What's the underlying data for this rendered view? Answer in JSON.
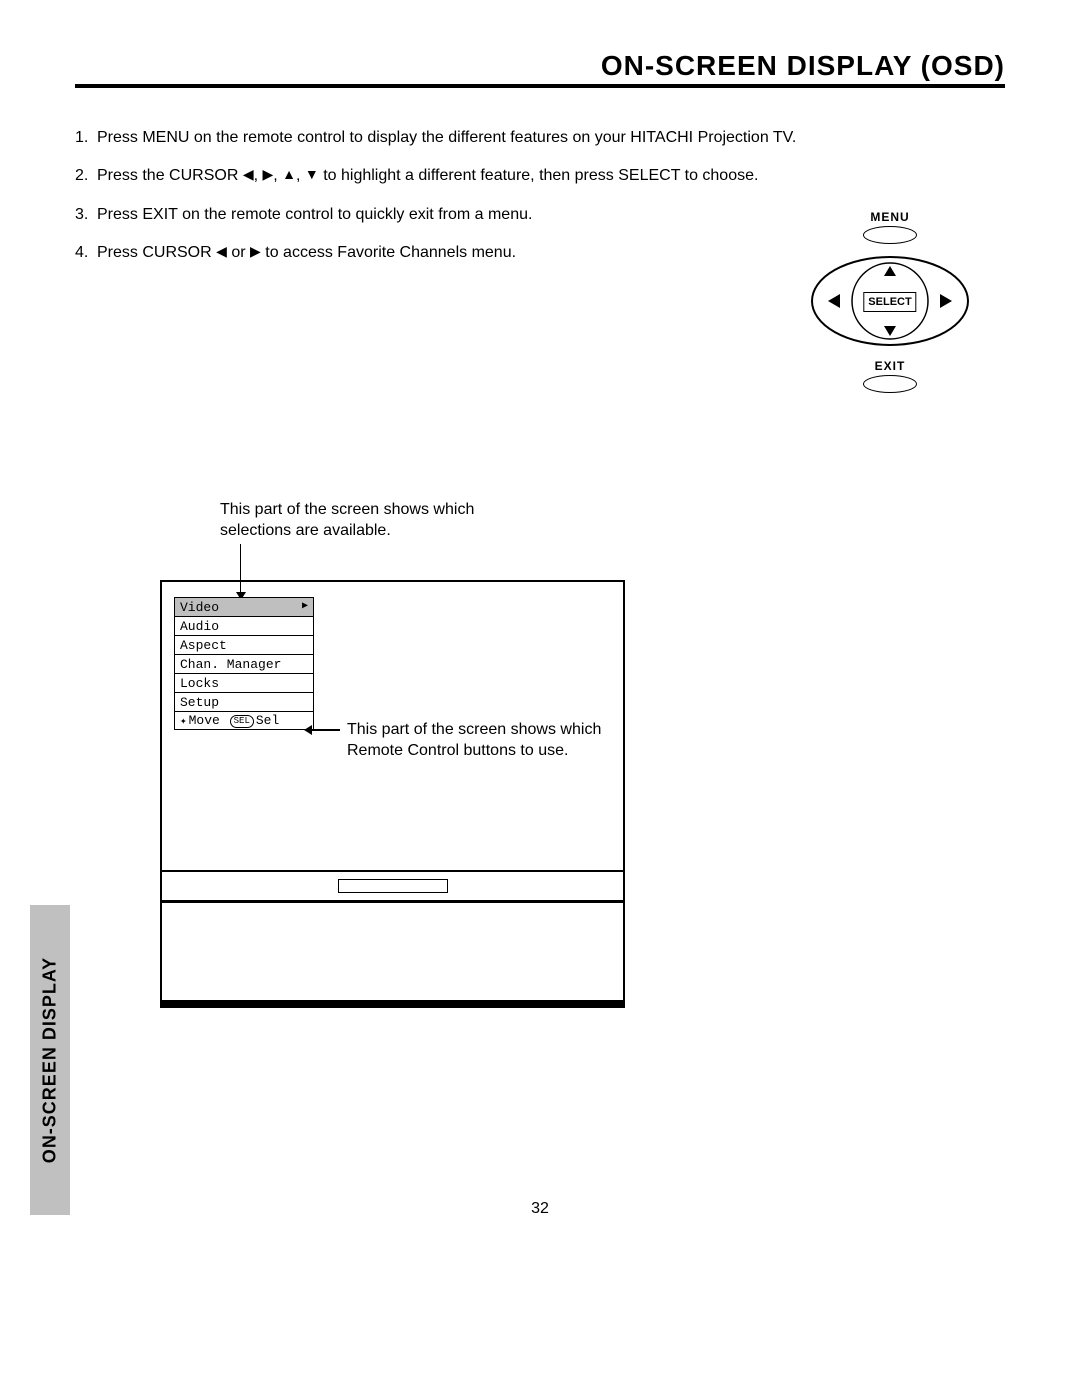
{
  "title": "ON-SCREEN DISPLAY (OSD)",
  "instructions": {
    "i1_a": "1.",
    "i1_b": "Press MENU on the remote control to display the different features on your HITACHI Projection TV.",
    "i2_a": "2.",
    "i2_b": "Press the CURSOR ",
    "i2_c": " to highlight a different feature, then press SELECT to choose.",
    "i3_a": "3.",
    "i3_b": "Press EXIT on the remote control to quickly exit from a menu.",
    "i4_a": "4.",
    "i4_b": "Press CURSOR ",
    "i4_c": " to access Favorite Channels menu."
  },
  "arrows": {
    "left": "◀",
    "right": "▶",
    "up": "▲",
    "down": "▼",
    "sep": ", ",
    "or": " or "
  },
  "remote": {
    "menu": "MENU",
    "select": "SELECT",
    "exit": "EXIT"
  },
  "callouts": {
    "top": "This part of the screen shows which selections are available.",
    "right": "This part of the screen shows which Remote Control buttons to use."
  },
  "menu": {
    "items": [
      "Video",
      "Audio",
      "Aspect",
      "Chan. Manager",
      "Locks",
      "Setup"
    ],
    "hint_move": "Move",
    "hint_sel_badge": "SEL",
    "hint_sel": "Sel",
    "row_arrow": "▶"
  },
  "side_tab": "ON-SCREEN DISPLAY",
  "page_num": "32"
}
